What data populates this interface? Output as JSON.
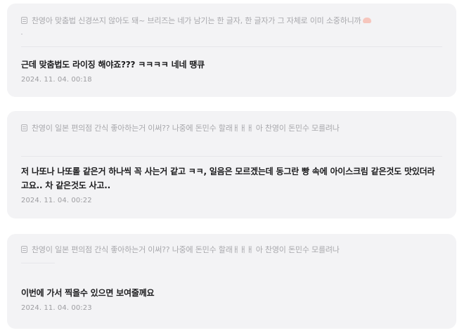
{
  "comments": [
    {
      "quote": "찬영아 맞춤법 신경쓰지 않아도 돼~ 브리즈는 네가 남기는 한 글자, 한 글자가 그 자체로 이미 소중하니까",
      "message": "근데 맞춤법도 라이징 해야죠??? ㅋㅋㅋㅋ 네네 땡큐",
      "time": "2024. 11. 04. 00:18"
    },
    {
      "quote": "찬영이 일본 편의점 간식 좋아하는거 이써?? 나중에 돈민수 할래ㅐㅐㅐ 아 찬영이 돈민수 모를려나",
      "message": "저 나또나 나또롤 같은거 하나씩 꼭 사는거 같고 ㅋㅋ, 일음은 모르겠는데 동그란 빵 속에 아이스크림 같은것도 맛있더라고요.. 차 같은것도 사고..",
      "time": "2024. 11. 04. 00:22"
    },
    {
      "quote": "찬영이 일본 편의점 간식 좋아하는거 이써?? 나중에 돈민수 할래ㅐㅐㅐ 아 찬영이 돈민수 모를려나",
      "message": "이번에 가서 찍을수 있으면 보여줄께요",
      "time": "2024. 11. 04. 00:23"
    }
  ],
  "icons": {
    "quote": "quote-icon",
    "emoji": "emoji-icon"
  },
  "colors": {
    "card_bg": "#f3f3f5",
    "quote_text": "#a8a8ac",
    "message_text": "#1c1c1e",
    "time_text": "#9d9da1"
  }
}
